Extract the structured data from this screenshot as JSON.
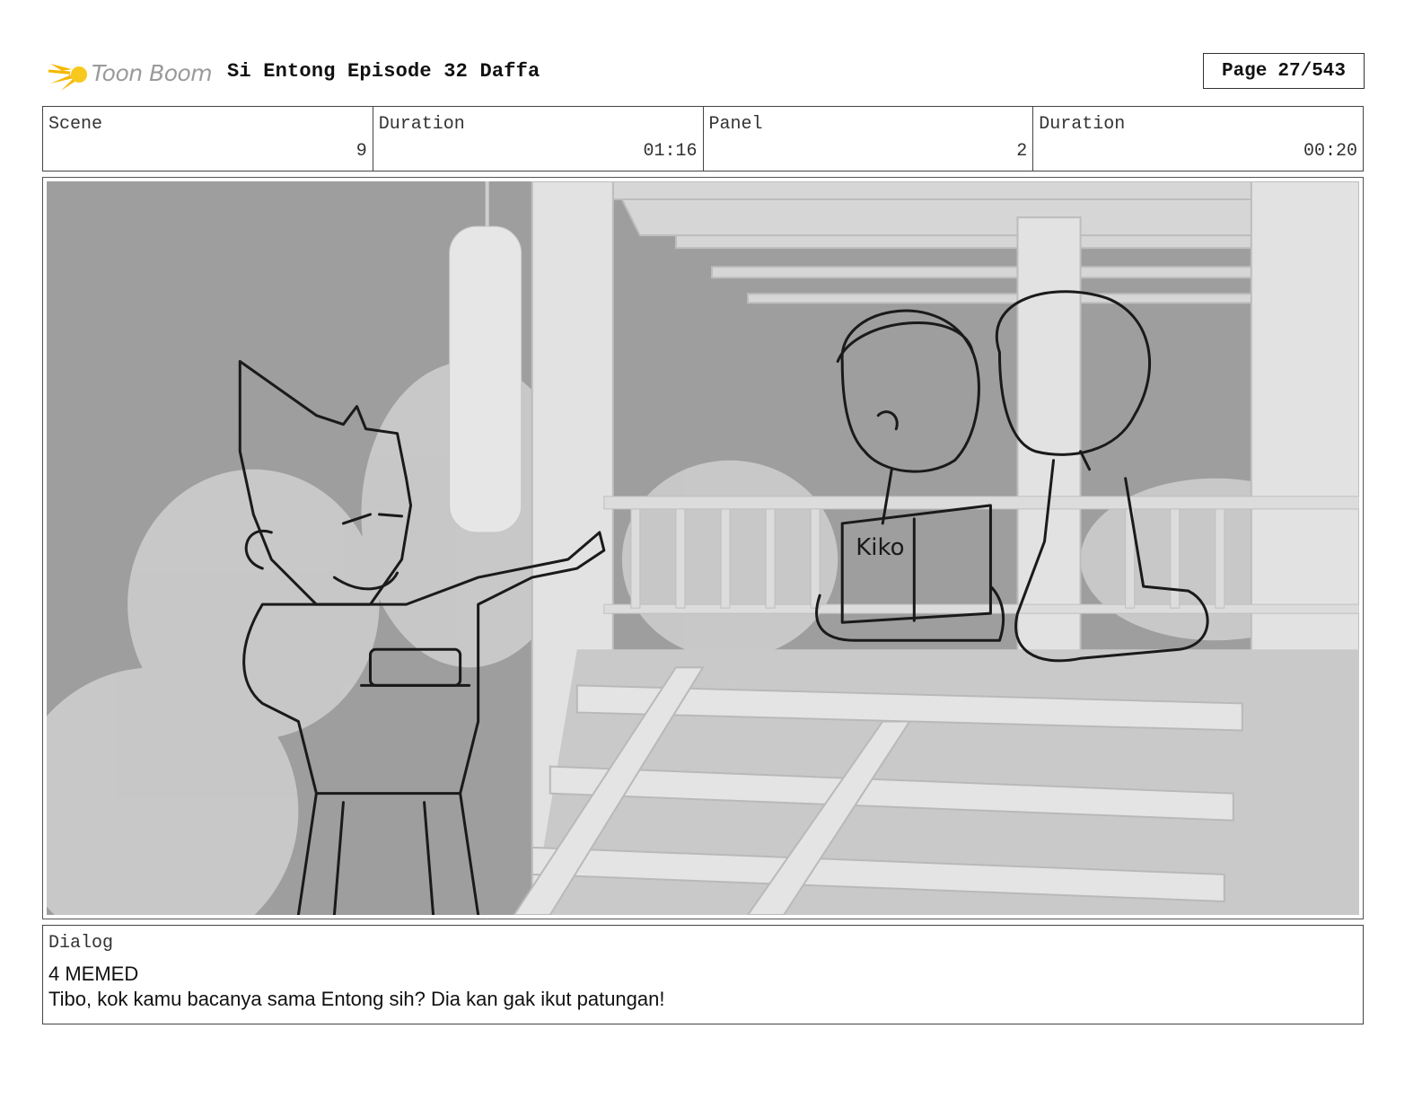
{
  "header": {
    "logo_text": "Toon Boom",
    "title": "Si Entong Episode 32 Daffa",
    "page_label": "Page",
    "page_value": "27/543"
  },
  "info": {
    "scene_label": "Scene",
    "scene_value": "9",
    "scene_duration_label": "Duration",
    "scene_duration_value": "01:16",
    "panel_label": "Panel",
    "panel_value": "2",
    "panel_duration_label": "Duration",
    "panel_duration_value": "00:20"
  },
  "dialog": {
    "label": "Dialog",
    "speaker": "4 MEMED",
    "line": "Tibo, kok kamu bacanya sama Entong sih? Dia kan gak ikut patungan!"
  },
  "art": {
    "book_title": "Kiko"
  },
  "colors": {
    "logo_accent": "#f5b800",
    "border": "#444444",
    "panel_gray": "#a9a9a9"
  }
}
